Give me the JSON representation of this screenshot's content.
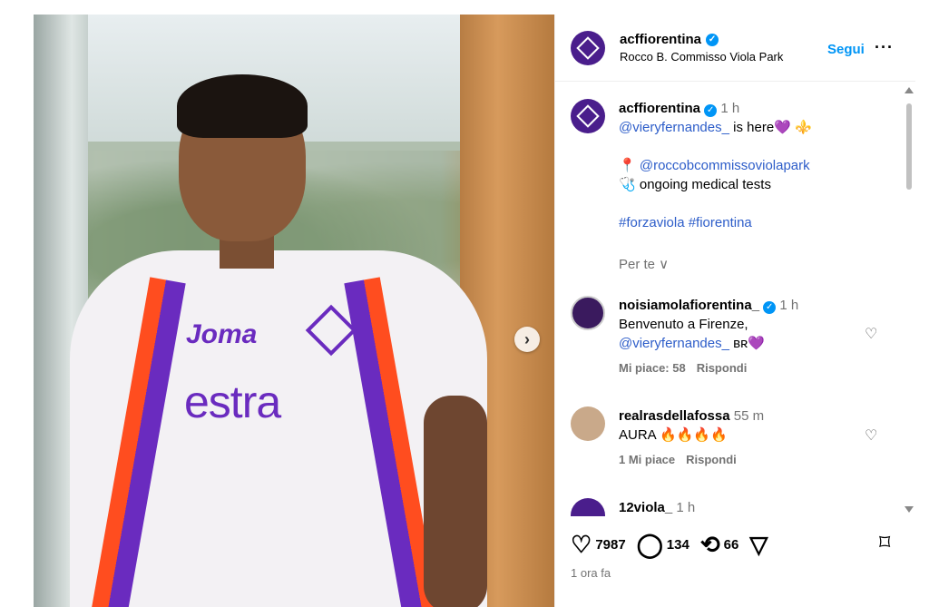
{
  "sponsor_text": "estra",
  "brand_text": "Joma",
  "post": {
    "username": "acffiorentina",
    "location": "Rocco B. Commisso Viola Park",
    "follow_label": "Segui",
    "more_label": "···"
  },
  "caption": {
    "username": "acffiorentina",
    "time": "1 h",
    "mention": "@vieryfernandes_",
    "line1_rest": " is here💜 ⚜️",
    "pin": "📍",
    "location_mention": "@roccobcommissoviolapark",
    "stethoscope": "🩺",
    "medical": " ongoing medical tests",
    "hashtags": "#forzaviola #fiorentina",
    "sort_label": "Per te ∨"
  },
  "comments": [
    {
      "username": "noisiamolafiorentina_",
      "time": "1 h",
      "line1": "Benvenuto a Firenze,",
      "mention": "@vieryfernandes_",
      "suffix": " ʙʀ💜",
      "likes": "Mi piace: 58",
      "reply": "Rispondi"
    },
    {
      "username": "realrasdellafossa",
      "time": "55 m",
      "text": "AURA 🔥🔥🔥🔥",
      "likes": "1 Mi piace",
      "reply": "Rispondi"
    },
    {
      "username": "12viola_",
      "time": "1 h"
    }
  ],
  "stats": {
    "likes": "7987",
    "comments": "134",
    "reposts": "66"
  },
  "time_ago": "1 ora fa",
  "colors": {
    "accent": "#0095f6",
    "link": "#2d5dc9",
    "viola": "#4a1e8c"
  }
}
